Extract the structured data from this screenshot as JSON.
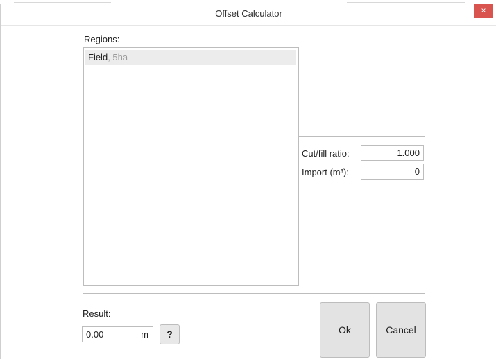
{
  "window": {
    "title": "Offset Calculator",
    "close_icon": "×"
  },
  "regions": {
    "label": "Regions:",
    "items": [
      {
        "name": "Field",
        "separator": ", ",
        "area": "5ha"
      }
    ]
  },
  "params": {
    "cut_fill_label": "Cut/fill ratio:",
    "cut_fill_value": "1.000",
    "import_label": "Import (m³):",
    "import_value": "0"
  },
  "result": {
    "label": "Result:",
    "value": "0.00",
    "unit": "m",
    "help_label": "?"
  },
  "buttons": {
    "ok_label": "Ok",
    "cancel_label": "Cancel"
  },
  "colors": {
    "close_bg": "#d9534f",
    "button_bg": "#e3e3e3",
    "selected_row_bg": "#ececec",
    "area_text": "#9a9a9a"
  }
}
